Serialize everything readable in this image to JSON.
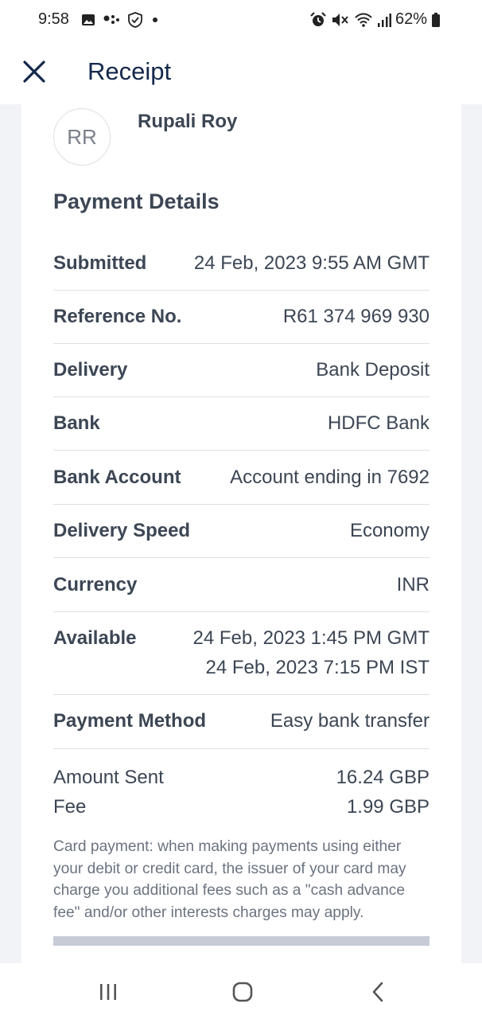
{
  "status_bar": {
    "time": "9:58",
    "battery": "62%",
    "icons": [
      "image-icon",
      "dots-icon",
      "shield-icon",
      "dot-icon",
      "alarm-icon",
      "mute-icon",
      "wifi-icon",
      "signal-icon",
      "battery-icon"
    ]
  },
  "header": {
    "title": "Receipt",
    "close_icon": "close-icon"
  },
  "recipient": {
    "initials": "RR",
    "name": "Rupali Roy"
  },
  "payment_details": {
    "title": "Payment Details",
    "rows": [
      {
        "label": "Submitted",
        "value": "24 Feb, 2023 9:55 AM GMT"
      },
      {
        "label": "Reference No.",
        "value": "R61 374 969 930"
      },
      {
        "label": "Delivery",
        "value": "Bank Deposit"
      },
      {
        "label": "Bank",
        "value": "HDFC Bank"
      },
      {
        "label": "Bank Account",
        "value": "Account ending in 7692"
      },
      {
        "label": "Delivery Speed",
        "value": "Economy"
      },
      {
        "label": "Currency",
        "value": "INR"
      },
      {
        "label": "Available",
        "value": "24 Feb, 2023 1:45 PM GMT",
        "value2": "24 Feb, 2023 7:15 PM IST"
      },
      {
        "label": "Payment Method",
        "value": "Easy bank transfer"
      }
    ]
  },
  "amounts": {
    "sent_label": "Amount Sent",
    "sent_value": "16.24 GBP",
    "fee_label": "Fee",
    "fee_value": "1.99 GBP"
  },
  "disclaimer": "Card payment: when making payments using either your debit or credit card, the issuer of your card may charge you additional fees such as a \"cash advance fee\" and/or other interests charges may apply.",
  "nav": {
    "recent_icon": "recent-apps-icon",
    "home_icon": "home-icon",
    "back_icon": "back-icon"
  }
}
